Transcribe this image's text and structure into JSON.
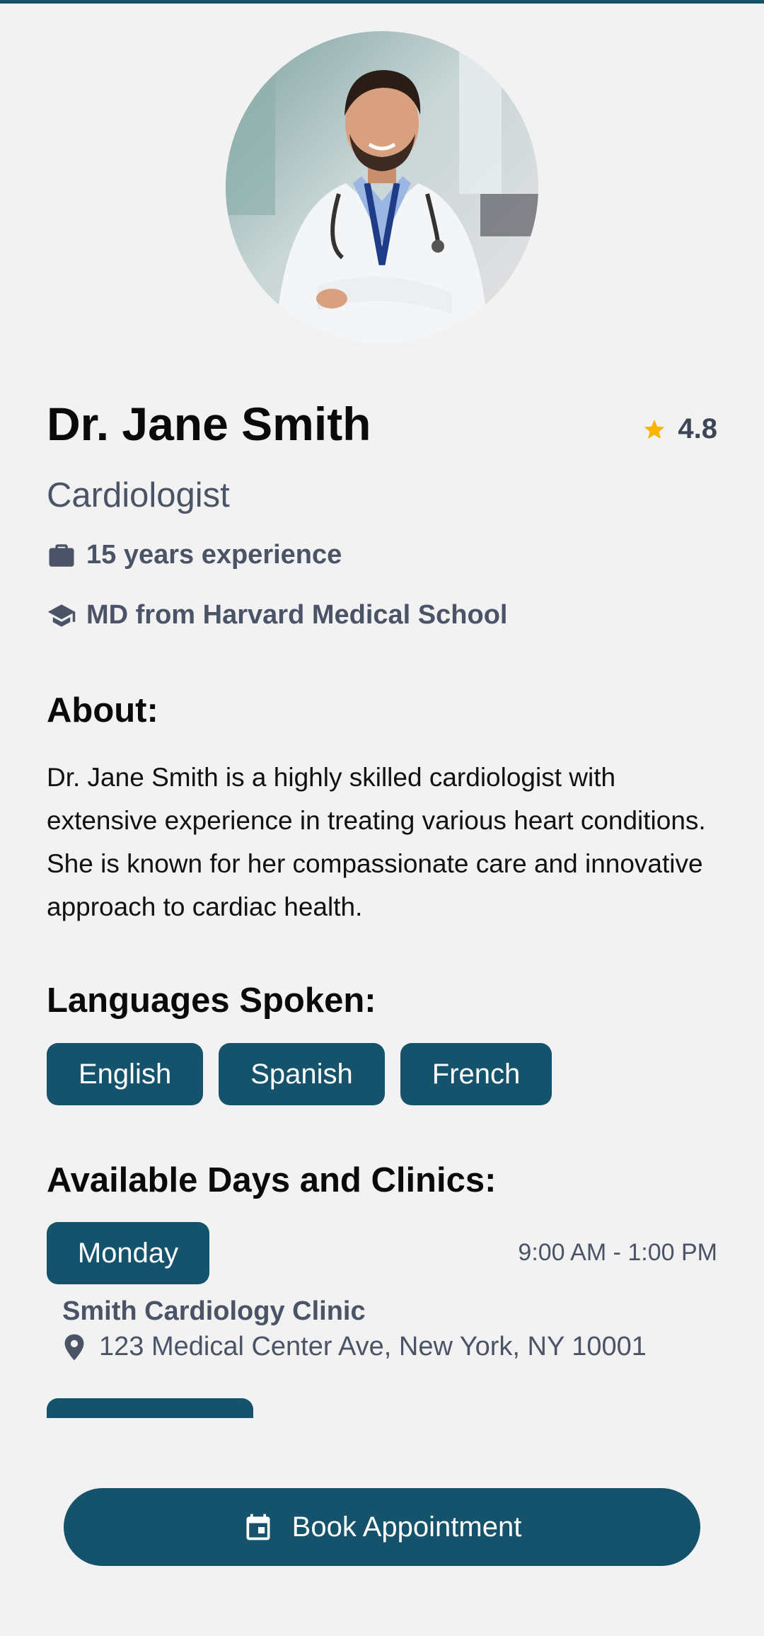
{
  "doctor": {
    "name": "Dr. Jane Smith",
    "specialty": "Cardiologist",
    "rating": "4.8",
    "experience": "15 years experience",
    "education": "MD from Harvard Medical School",
    "photo_icon": "doctor-portrait"
  },
  "about": {
    "title": "About:",
    "text": "Dr. Jane Smith is a highly skilled cardiologist with extensive experience in treating various heart conditions. She is known for her compassionate care and innovative approach to cardiac health."
  },
  "languages": {
    "title": "Languages Spoken:",
    "items": [
      "English",
      "Spanish",
      "French"
    ]
  },
  "availability": {
    "title": "Available Days and Clinics:",
    "days": [
      {
        "day": "Monday",
        "hours": "9:00 AM - 1:00 PM",
        "clinic": "Smith Cardiology Clinic",
        "address": "123 Medical Center Ave, New York, NY 10001"
      }
    ]
  },
  "actions": {
    "book_label": "Book Appointment"
  },
  "colors": {
    "primary": "#14536b",
    "star": "#f7b500",
    "muted_text": "#4a5466",
    "background": "#f2f2f3"
  },
  "icons": {
    "rating": "star-icon",
    "experience": "briefcase-icon",
    "education": "graduation-cap-icon",
    "address": "location-pin-icon",
    "book": "calendar-icon"
  }
}
